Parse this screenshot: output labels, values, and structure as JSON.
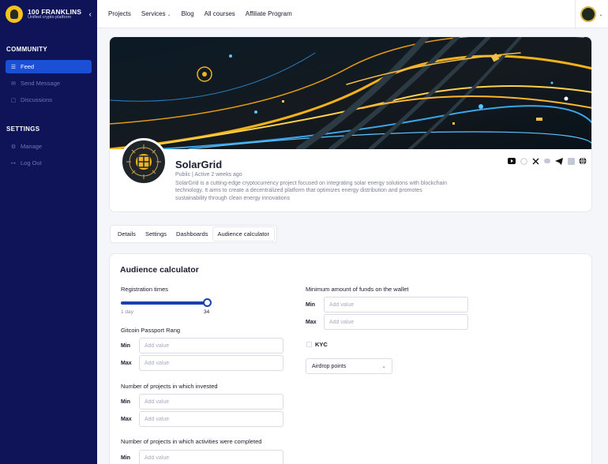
{
  "brand": {
    "name": "100 FRANKLINS",
    "tagline": "Unified crypto platform"
  },
  "sidebar": {
    "community_heading": "COMMUNITY",
    "community_items": [
      {
        "label": "Feed",
        "icon": "list-icon",
        "active": true
      },
      {
        "label": "Send Message",
        "icon": "mail-icon",
        "active": false
      },
      {
        "label": "Discussions",
        "icon": "chat-icon",
        "active": false
      }
    ],
    "settings_heading": "SETTINGS",
    "settings_items": [
      {
        "label": "Manage",
        "icon": "gear-icon"
      },
      {
        "label": "Log Out",
        "icon": "logout-icon"
      }
    ]
  },
  "topnav": [
    "Projects",
    "Services",
    "Blog",
    "All courses",
    "Affiliate Program"
  ],
  "project": {
    "name": "SolarGrid",
    "meta": "Public | Active 2 weeks ago",
    "description": "SolarGrid is a cutting-edge cryptocurrency project focused on integrating solar energy solutions with blockchain technology. It aims to create a decentralized platform that optimizes energy distribution and promotes sustainability through clean energy innovations",
    "socials": [
      "youtube-icon",
      "github-icon",
      "x-icon",
      "discord-icon",
      "telegram-icon",
      "linkedin-icon",
      "globe-icon"
    ]
  },
  "tabs": [
    "Details",
    "Settings",
    "Dashboards",
    "Audience calculator"
  ],
  "active_tab": "Audience calculator",
  "calculator": {
    "title": "Audience calculator",
    "registration": {
      "label": "Registration times",
      "min_label": "1 day",
      "value_label": "34",
      "fill_fraction": 0.95
    },
    "gitcoin_label": "Gitcoin Passport Rang",
    "invested_label": "Number of projects in which invested",
    "activities_label": "Number of projects in which activities were completed",
    "funds_label": "Minimum amount of funds on the wallet",
    "min_label": "Min",
    "max_label": "Max",
    "placeholder": "Add value",
    "kyc_label": "KYC",
    "airdrop_select": "Airdrop points"
  },
  "colors": {
    "sidebar_bg": "#0e1457",
    "accent": "#1a4fd6",
    "slider": "#1a3fb0"
  }
}
